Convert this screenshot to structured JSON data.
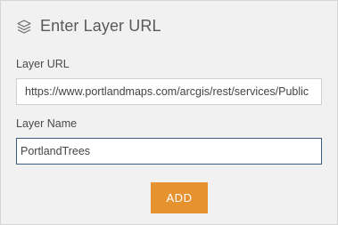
{
  "header": {
    "title": "Enter Layer URL",
    "icon": "layers-icon"
  },
  "form": {
    "url_label": "Layer URL",
    "url_value": "https://www.portlandmaps.com/arcgis/rest/services/Public",
    "name_label": "Layer Name",
    "name_value": "PortlandTrees"
  },
  "actions": {
    "add_label": "ADD",
    "add_color": "#e6922f"
  }
}
